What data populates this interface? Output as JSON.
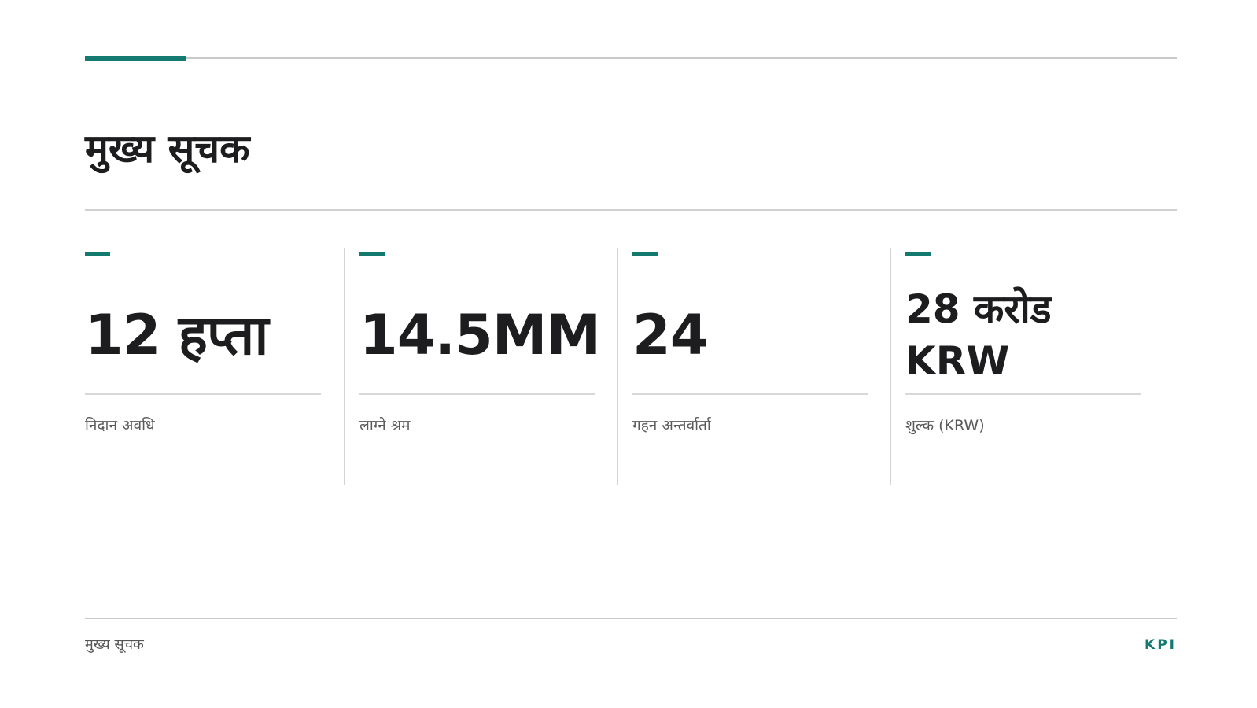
{
  "header": {
    "title": "मुख्य सूचक"
  },
  "kpis": [
    {
      "value": "12 हप्ता",
      "label": "निदान अवधि"
    },
    {
      "value": "14.5MM",
      "label": "लाग्ने श्रम"
    },
    {
      "value": "24",
      "label": "गहन अन्तर्वार्ता"
    },
    {
      "value": "28 करोड KRW",
      "label": "शुल्क (KRW)"
    }
  ],
  "footer": {
    "title": "मुख्य सूचक",
    "tag": "KPI"
  },
  "colors": {
    "accent": "#137a70",
    "text": "#1d1d1f",
    "muted": "#5a5a5a",
    "rule": "#d0d0d0"
  }
}
